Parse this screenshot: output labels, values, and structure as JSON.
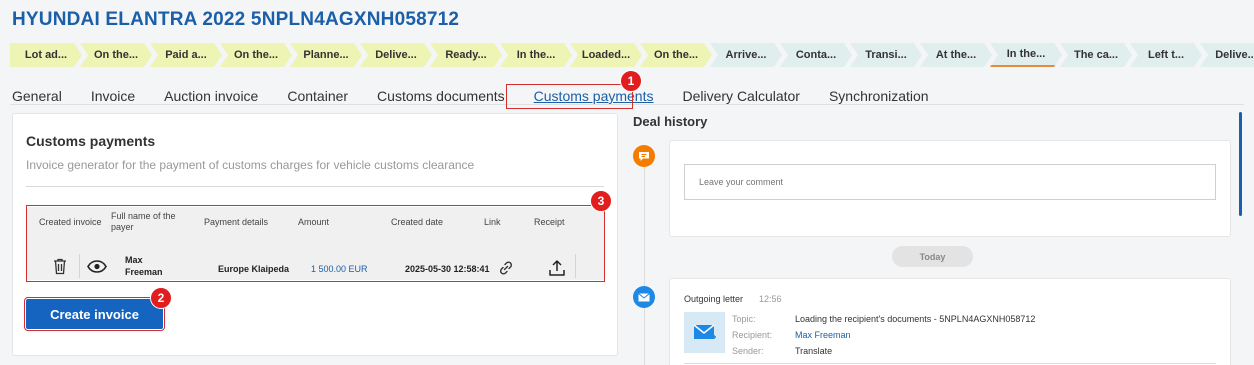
{
  "page_title": "HYUNDAI ELANTRA 2022 5NPLN4AGXNH058712",
  "stages": [
    {
      "label": "Lot ad...",
      "state": "done"
    },
    {
      "label": "On the...",
      "state": "done"
    },
    {
      "label": "Paid a...",
      "state": "done"
    },
    {
      "label": "On the...",
      "state": "done"
    },
    {
      "label": "Planne...",
      "state": "done"
    },
    {
      "label": "Delive...",
      "state": "done"
    },
    {
      "label": "Ready...",
      "state": "done"
    },
    {
      "label": "In the...",
      "state": "done"
    },
    {
      "label": "Loaded...",
      "state": "done"
    },
    {
      "label": "On the...",
      "state": "done"
    },
    {
      "label": "Arrive...",
      "state": "todo"
    },
    {
      "label": "Conta...",
      "state": "todo"
    },
    {
      "label": "Transi...",
      "state": "todo"
    },
    {
      "label": "At the...",
      "state": "todo"
    },
    {
      "label": "In the...",
      "state": "todo-mid"
    },
    {
      "label": "The ca...",
      "state": "todo"
    },
    {
      "label": "Left t...",
      "state": "todo"
    },
    {
      "label": "Delive...",
      "state": "todo"
    }
  ],
  "tabs": [
    "General",
    "Invoice",
    "Auction invoice",
    "Container",
    "Customs documents",
    "Customs payments",
    "Delivery Calculator",
    "Synchronization"
  ],
  "active_tab": "Customs payments",
  "annotations": [
    "1",
    "2",
    "3"
  ],
  "panel": {
    "title": "Customs payments",
    "subtitle": "Invoice generator for the payment of customs charges for vehicle customs clearance",
    "columns": {
      "created_invoice": "Created invoice",
      "payer": "Full name of the payer",
      "details": "Payment details",
      "amount": "Amount",
      "date": "Created date",
      "link": "Link",
      "receipt": "Receipt"
    },
    "row": {
      "payer": "Max Freeman",
      "details": "Europe Klaipeda",
      "amount": "1 500.00 EUR",
      "date": "2025-05-30 12:58:41"
    },
    "create_button": "Create invoice"
  },
  "history": {
    "title": "Deal history",
    "comment_placeholder": "Leave your comment",
    "today": "Today",
    "letter": {
      "title": "Outgoing letter",
      "time": "12:56",
      "topic_label": "Topic:",
      "topic": "Loading the recipient's documents - 5NPLN4AGXNH058712",
      "recipient_label": "Recipient:",
      "recipient": "Max Freeman",
      "sender_label": "Sender:",
      "sender": "Translate"
    }
  },
  "colors": {
    "accent": "#1a5fa8",
    "stage_done": "#eef4b3",
    "stage_todo": "#e1eeee",
    "annotation_red": "#e11d1d",
    "button_blue": "#1565c0",
    "comment_icon": "#f57c00",
    "letter_icon": "#1e88e5"
  }
}
